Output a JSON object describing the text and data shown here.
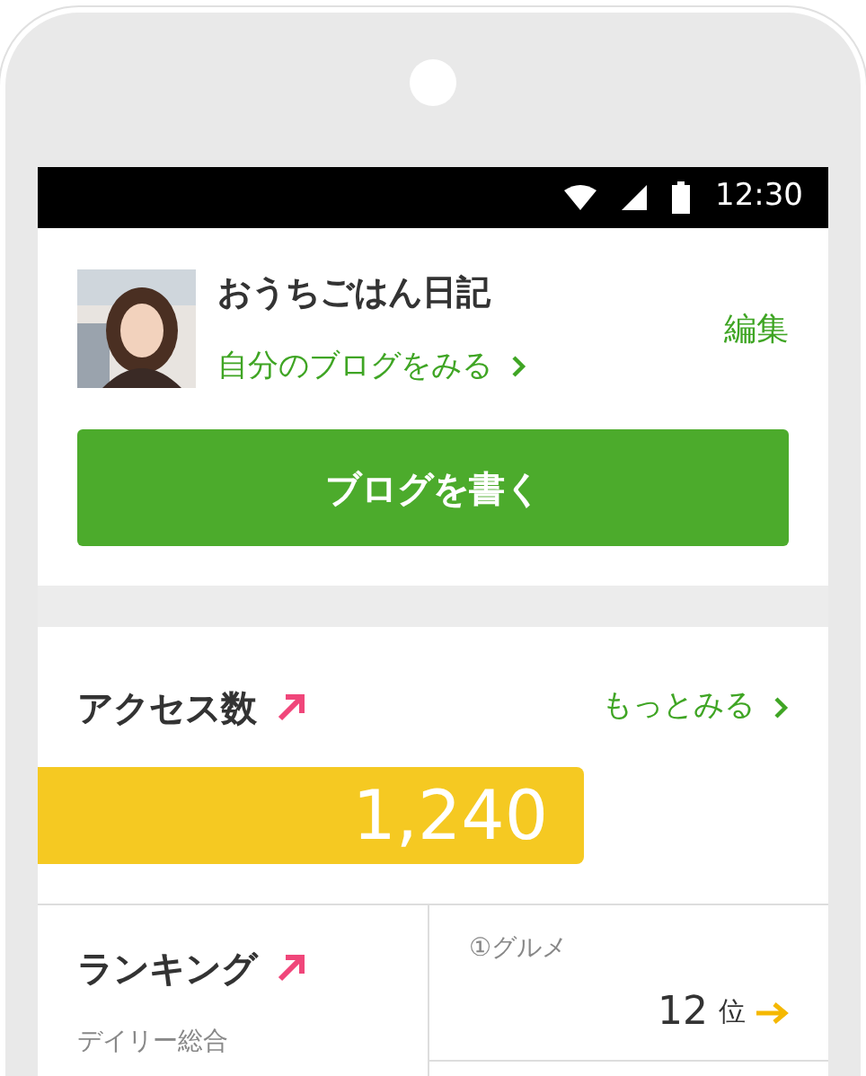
{
  "status_bar": {
    "time": "12:30"
  },
  "profile": {
    "title": "おうちごはん日記",
    "link": "自分のブログをみる",
    "edit": "編集"
  },
  "write_button": "ブログを書く",
  "access": {
    "title": "アクセス数",
    "more": "もっとみる",
    "count": "1,240"
  },
  "ranking": {
    "title": "ランキング",
    "period": "デイリー総合",
    "category": "①グルメ",
    "rank": "12",
    "unit": "位"
  }
}
